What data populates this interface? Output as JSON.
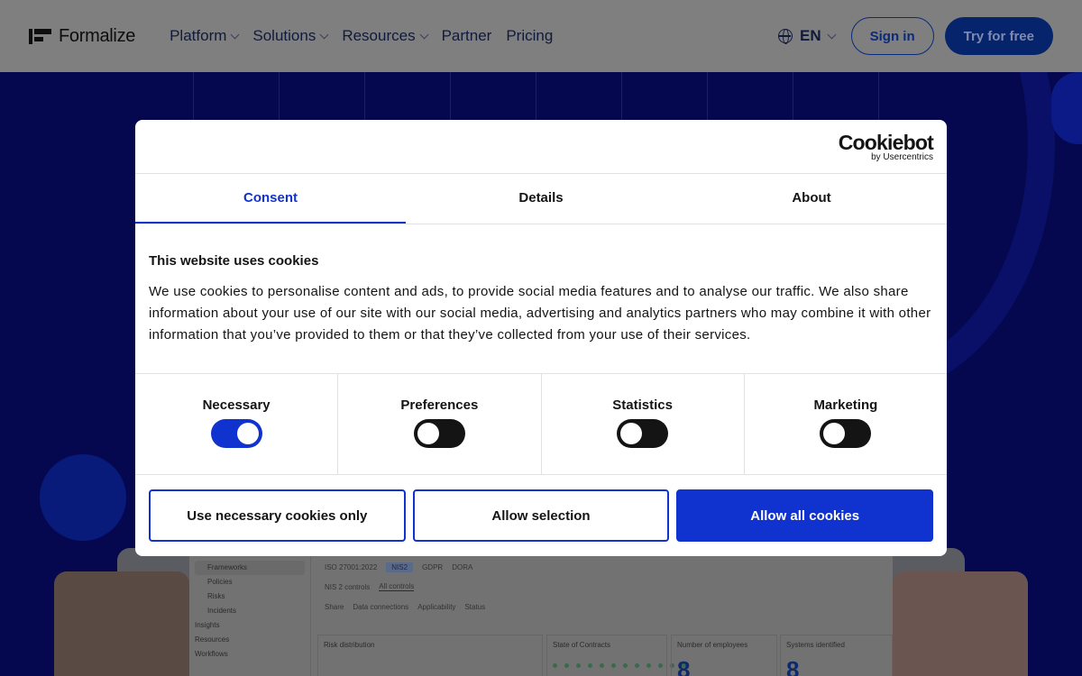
{
  "header": {
    "brand": "Formalize",
    "nav": [
      {
        "label": "Platform",
        "dropdown": true
      },
      {
        "label": "Solutions",
        "dropdown": true
      },
      {
        "label": "Resources",
        "dropdown": true
      },
      {
        "label": "Partner",
        "dropdown": false
      },
      {
        "label": "Pricing",
        "dropdown": false
      }
    ],
    "language": "EN",
    "sign_in": "Sign in",
    "try_free": "Try for free"
  },
  "preview": {
    "sidebar": [
      "Frameworks",
      "Policies",
      "Risks",
      "Incidents",
      "Insights",
      "Resources",
      "Workflows"
    ],
    "framework_tabs": [
      "ISO 27001:2022",
      "NIS2",
      "GDPR",
      "DORA"
    ],
    "control_tabs": [
      "NIS 2 controls",
      "All controls"
    ],
    "filters": [
      "Share",
      "Data connections",
      "Applicability",
      "Status"
    ],
    "risk_distribution": "Risk distribution",
    "state_of_contracts": "State of Contracts",
    "employees_label": "Number of employees",
    "employees_value": "8",
    "systems_label": "Systems identified",
    "systems_value": "8"
  },
  "cookie": {
    "logo_word": "Cookiebot",
    "logo_sub": "by Usercentrics",
    "tabs": [
      "Consent",
      "Details",
      "About"
    ],
    "active_tab": "Consent",
    "title": "This website uses cookies",
    "text": "We use cookies to personalise content and ads, to provide social media features and to analyse our traffic. We also share information about your use of our site with our social media, advertising and analytics partners who may combine it with other information that you’ve provided to them or that they’ve collected from your use of their services.",
    "categories": [
      {
        "label": "Necessary",
        "enabled": true
      },
      {
        "label": "Preferences",
        "enabled": false
      },
      {
        "label": "Statistics",
        "enabled": false
      },
      {
        "label": "Marketing",
        "enabled": false
      }
    ],
    "btn_necessary": "Use necessary cookies only",
    "btn_selection": "Allow selection",
    "btn_all": "Allow all cookies"
  },
  "colors": {
    "accent": "#1032cf",
    "hero_bg": "#06084f",
    "header_bg": "#7f7f7f"
  }
}
